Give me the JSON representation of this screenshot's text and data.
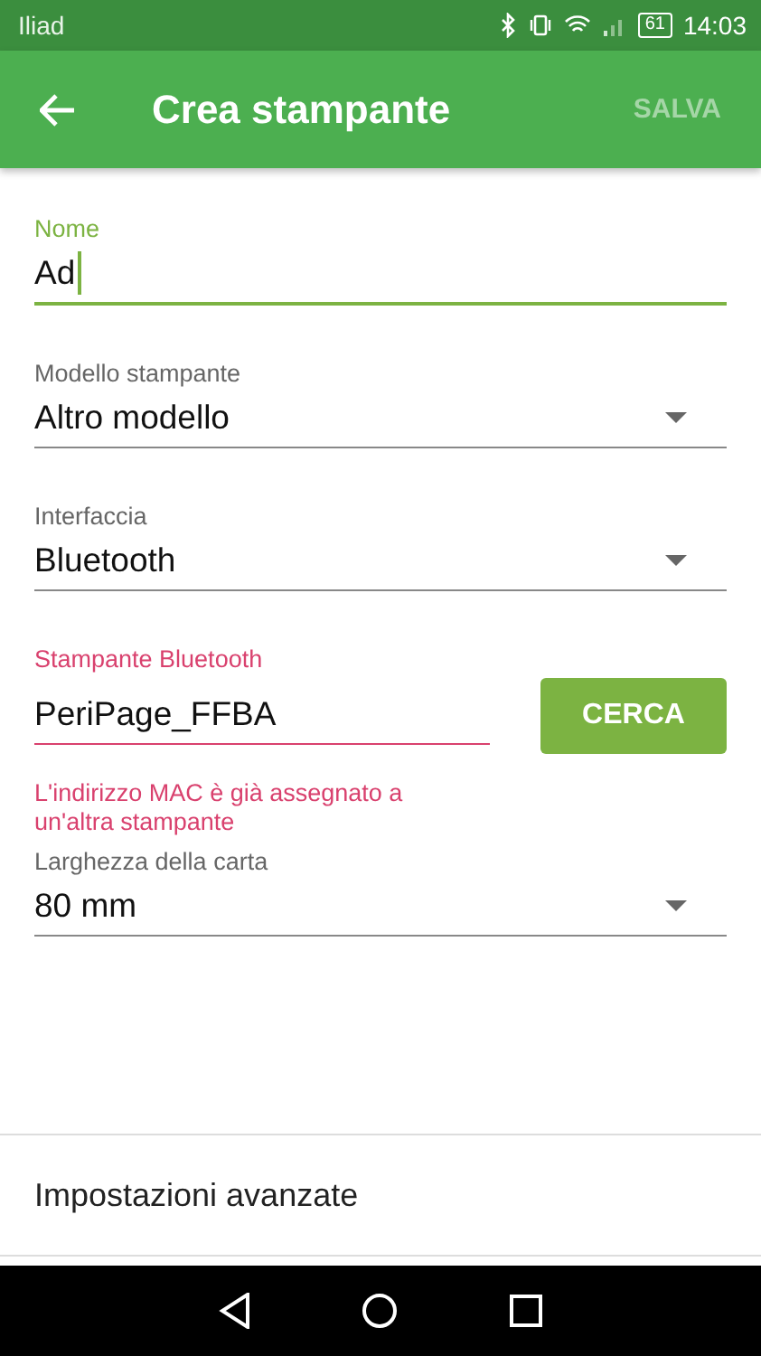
{
  "status_bar": {
    "carrier": "Iliad",
    "battery": "61",
    "time": "14:03"
  },
  "toolbar": {
    "title": "Crea stampante",
    "action": "SALVA"
  },
  "fields": [
    {
      "kind": "text",
      "label": "Nome",
      "value": "Ad",
      "focused": true,
      "error": false
    },
    {
      "kind": "dropdown",
      "label": "Modello stampante",
      "value": "Altro modello",
      "focused": false,
      "error": false
    },
    {
      "kind": "dropdown",
      "label": "Interfaccia",
      "value": "Bluetooth",
      "focused": false,
      "error": false
    },
    {
      "kind": "search",
      "label": "Stampante Bluetooth",
      "value": "PeriPage_FFBA",
      "button": "CERCA",
      "focused": false,
      "error": true,
      "error_text": "L'indirizzo MAC è già assegnato a un'altra stampante"
    },
    {
      "kind": "dropdown",
      "label": "Larghezza della carta",
      "value": "80 mm",
      "focused": false,
      "error": false
    }
  ],
  "advanced": {
    "label": "Impostazioni avanzate"
  }
}
